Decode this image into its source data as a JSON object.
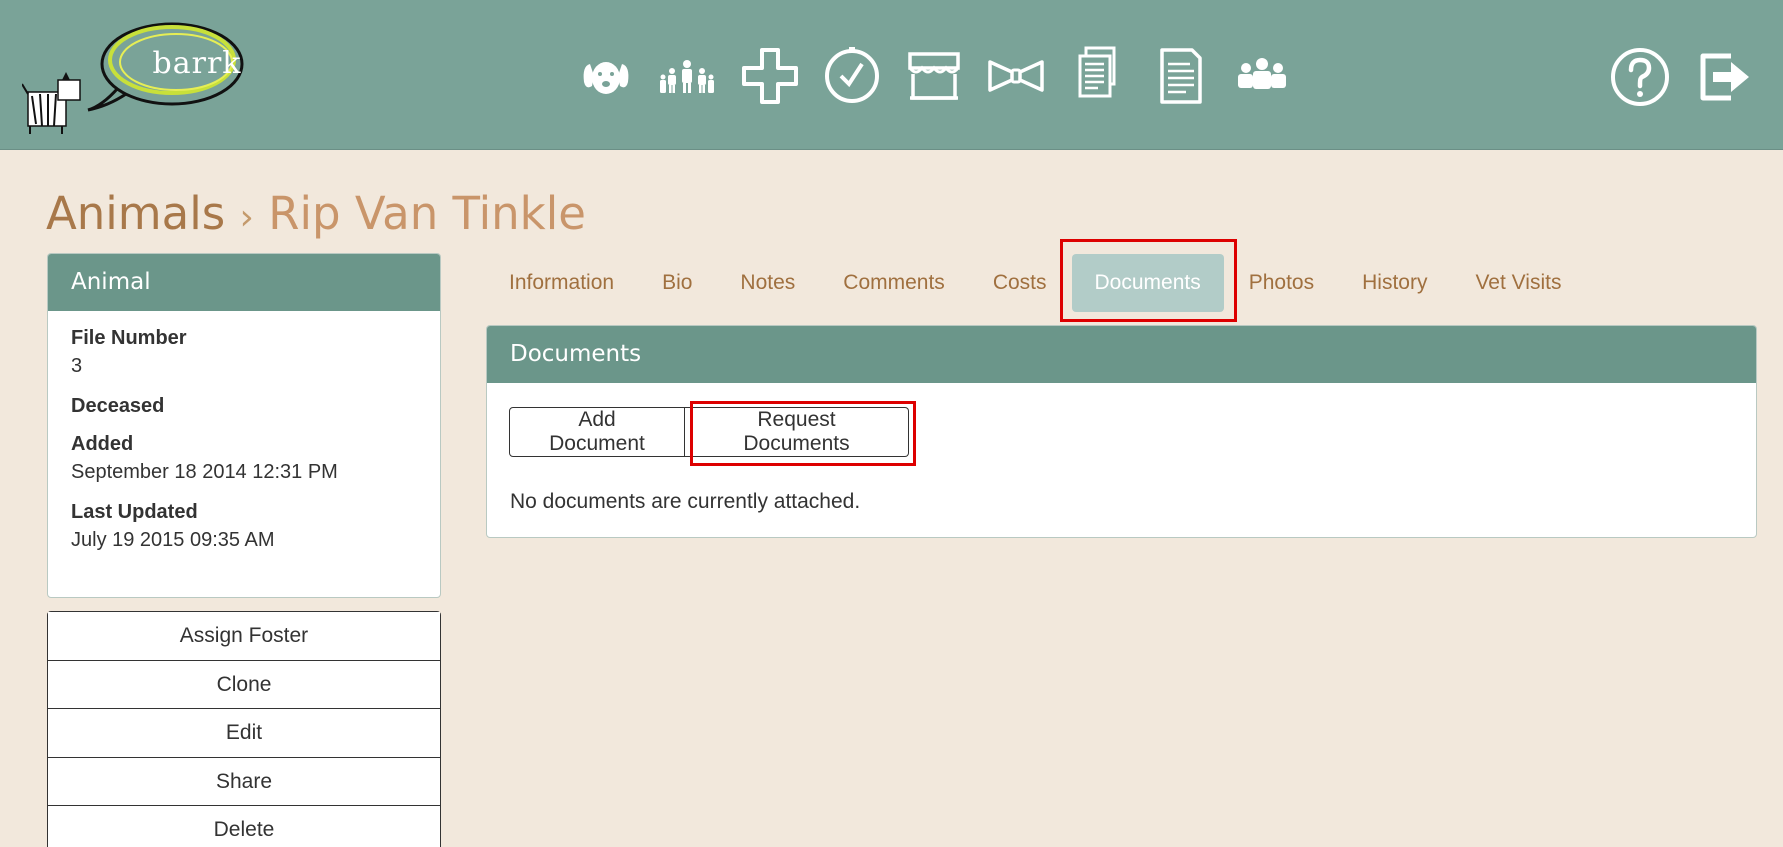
{
  "app": {
    "logo_text": "barrk"
  },
  "nav": {
    "icons": [
      "dog-icon",
      "family-icon",
      "medical-cross-icon",
      "clock-check-icon",
      "storefront-icon",
      "bowtie-icon",
      "documents-stack-icon",
      "document-icon",
      "team-icon"
    ],
    "right_icons": [
      "help-icon",
      "logout-icon"
    ]
  },
  "breadcrumb": {
    "root": "Animals",
    "separator": "›",
    "current": "Rip Van Tinkle"
  },
  "animal_panel": {
    "title": "Animal",
    "fields": [
      {
        "label": "File Number",
        "value": "3"
      },
      {
        "label": "Deceased",
        "value": ""
      },
      {
        "label": "Added",
        "value": "September 18 2014 12:31 PM"
      },
      {
        "label": "Last Updated",
        "value": "July 19 2015 09:35 AM"
      }
    ]
  },
  "actions": {
    "assign_foster": "Assign Foster",
    "clone": "Clone",
    "edit": "Edit",
    "share": "Share",
    "delete": "Delete"
  },
  "tabs": {
    "information": "Information",
    "bio": "Bio",
    "notes": "Notes",
    "comments": "Comments",
    "costs": "Costs",
    "documents": "Documents",
    "photos": "Photos",
    "history": "History",
    "vet_visits": "Vet Visits",
    "active": "documents"
  },
  "documents": {
    "title": "Documents",
    "add_label": "Add Document",
    "request_label": "Request Documents",
    "empty_message": "No documents are currently attached."
  },
  "colors": {
    "header_bg": "#7aa398",
    "panel_head": "#6b968a",
    "page_bg": "#f2e8dc",
    "tab_text": "#a0703f",
    "active_tab": "#b2ccc8",
    "highlight": "#dd0000"
  }
}
